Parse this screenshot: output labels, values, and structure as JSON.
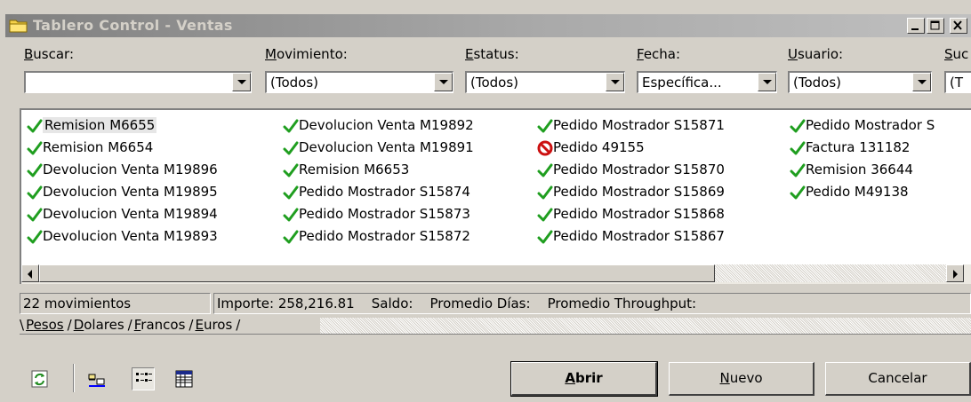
{
  "window": {
    "title": "Tablero Control - Ventas"
  },
  "filters": {
    "buscar": {
      "label_key": "B",
      "label_rest": "uscar:",
      "value": ""
    },
    "movimiento": {
      "label_key": "M",
      "label_rest": "ovimiento:",
      "value": "(Todos)"
    },
    "estatus": {
      "label_key": "E",
      "label_rest": "status:",
      "value": "(Todos)"
    },
    "fecha": {
      "label_key": "F",
      "label_rest": "echa:",
      "value": "Específica..."
    },
    "usuario": {
      "label_key": "U",
      "label_rest": "suario:",
      "value": "(Todos)"
    },
    "sucursal": {
      "label_key": "S",
      "label_rest": "uc",
      "value": "(T"
    }
  },
  "list": {
    "columns": [
      [
        {
          "label": "Remision M6655",
          "status": "ok",
          "selected": true
        },
        {
          "label": "Remision M6654",
          "status": "ok"
        },
        {
          "label": "Devolucion Venta M19896",
          "status": "ok"
        },
        {
          "label": "Devolucion Venta M19895",
          "status": "ok"
        },
        {
          "label": "Devolucion Venta M19894",
          "status": "ok"
        },
        {
          "label": "Devolucion Venta M19893",
          "status": "ok"
        }
      ],
      [
        {
          "label": "Devolucion Venta M19892",
          "status": "ok"
        },
        {
          "label": "Devolucion Venta M19891",
          "status": "ok"
        },
        {
          "label": "Remision M6653",
          "status": "ok"
        },
        {
          "label": "Pedido Mostrador S15874",
          "status": "ok"
        },
        {
          "label": "Pedido Mostrador S15873",
          "status": "ok"
        },
        {
          "label": "Pedido Mostrador S15872",
          "status": "ok"
        }
      ],
      [
        {
          "label": "Pedido Mostrador S15871",
          "status": "ok"
        },
        {
          "label": "Pedido 49155",
          "status": "cancelled"
        },
        {
          "label": "Pedido Mostrador S15870",
          "status": "ok"
        },
        {
          "label": "Pedido Mostrador S15869",
          "status": "ok"
        },
        {
          "label": "Pedido Mostrador S15868",
          "status": "ok"
        },
        {
          "label": "Pedido Mostrador S15867",
          "status": "ok"
        }
      ],
      [
        {
          "label": "Pedido Mostrador S",
          "status": "ok"
        },
        {
          "label": "Factura 131182",
          "status": "ok"
        },
        {
          "label": "Remision 36644",
          "status": "ok"
        },
        {
          "label": "Pedido M49138",
          "status": "ok"
        }
      ]
    ]
  },
  "status_bar": {
    "count": "22 movimientos",
    "summary": "Importe: 258,216.81    Saldo:    Promedio Días:    Promedio Throughput:"
  },
  "tabs": [
    {
      "key": "P",
      "rest": "esos",
      "active": true
    },
    {
      "key": "D",
      "rest": "olares",
      "active": false
    },
    {
      "key": "F",
      "rest": "rancos",
      "active": false
    },
    {
      "key": "E",
      "rest": "uros",
      "active": false
    }
  ],
  "buttons": {
    "abrir": {
      "key": "A",
      "rest": "brir"
    },
    "nuevo": {
      "key": "N",
      "rest": "uevo"
    },
    "cancelar": "Cancelar"
  },
  "colors": {
    "ok_check": "#1f9e1f",
    "cancel": "#cc1010"
  },
  "icons": {
    "toolbar": [
      "refresh-icon",
      "large-icons-view-icon",
      "list-view-icon",
      "details-view-icon"
    ]
  }
}
